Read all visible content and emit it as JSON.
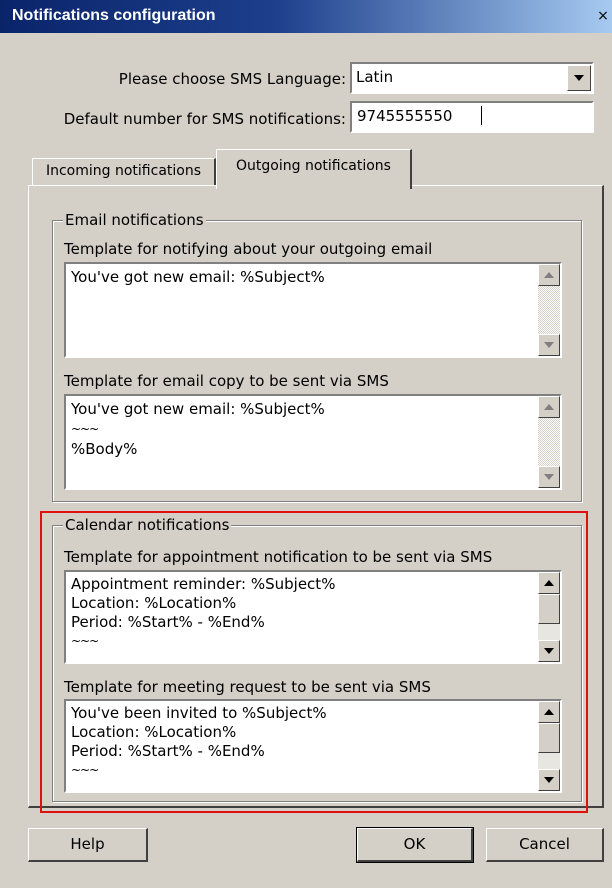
{
  "window": {
    "title": "Notifications configuration",
    "close_glyph": "×"
  },
  "settings": {
    "sms_language_label": "Please choose SMS Language:",
    "sms_language_value": "Latin",
    "default_number_label": "Default number for SMS notifications:",
    "default_number_value": "9745555550"
  },
  "tabs": [
    {
      "label": "Incoming notifications",
      "active": false
    },
    {
      "label": "Outgoing notifications",
      "active": true
    }
  ],
  "email_group": {
    "title": "Email notifications",
    "outgoing_label": "Template for notifying about your outgoing email",
    "outgoing_lines": [
      "You've got new email: %Subject%"
    ],
    "copy_label": "Template for email copy to be sent via SMS",
    "copy_lines": [
      "You've got new email: %Subject%",
      "~~~",
      "%Body%"
    ]
  },
  "calendar_group": {
    "title": "Calendar notifications",
    "appointment_label": "Template for appointment notification to be sent via SMS",
    "appointment_lines": [
      "Appointment reminder: %Subject%",
      "Location: %Location%",
      "Period: %Start% - %End%",
      "~~~"
    ],
    "meeting_label": "Template for meeting request to be sent via SMS",
    "meeting_lines": [
      "You've been invited to %Subject%",
      "Location: %Location%",
      "Period: %Start% - %End%",
      "~~~"
    ]
  },
  "buttons": {
    "help": "Help",
    "ok": "OK",
    "cancel": "Cancel"
  },
  "colors": {
    "highlight": "#e01010",
    "titlebar": "#0a246a",
    "dialog_bg": "#d4d0c8"
  },
  "icons": {
    "close": "close-icon",
    "dropdown": "chevron-down-icon",
    "scroll_up": "scroll-up-icon",
    "scroll_down": "scroll-down-icon"
  }
}
